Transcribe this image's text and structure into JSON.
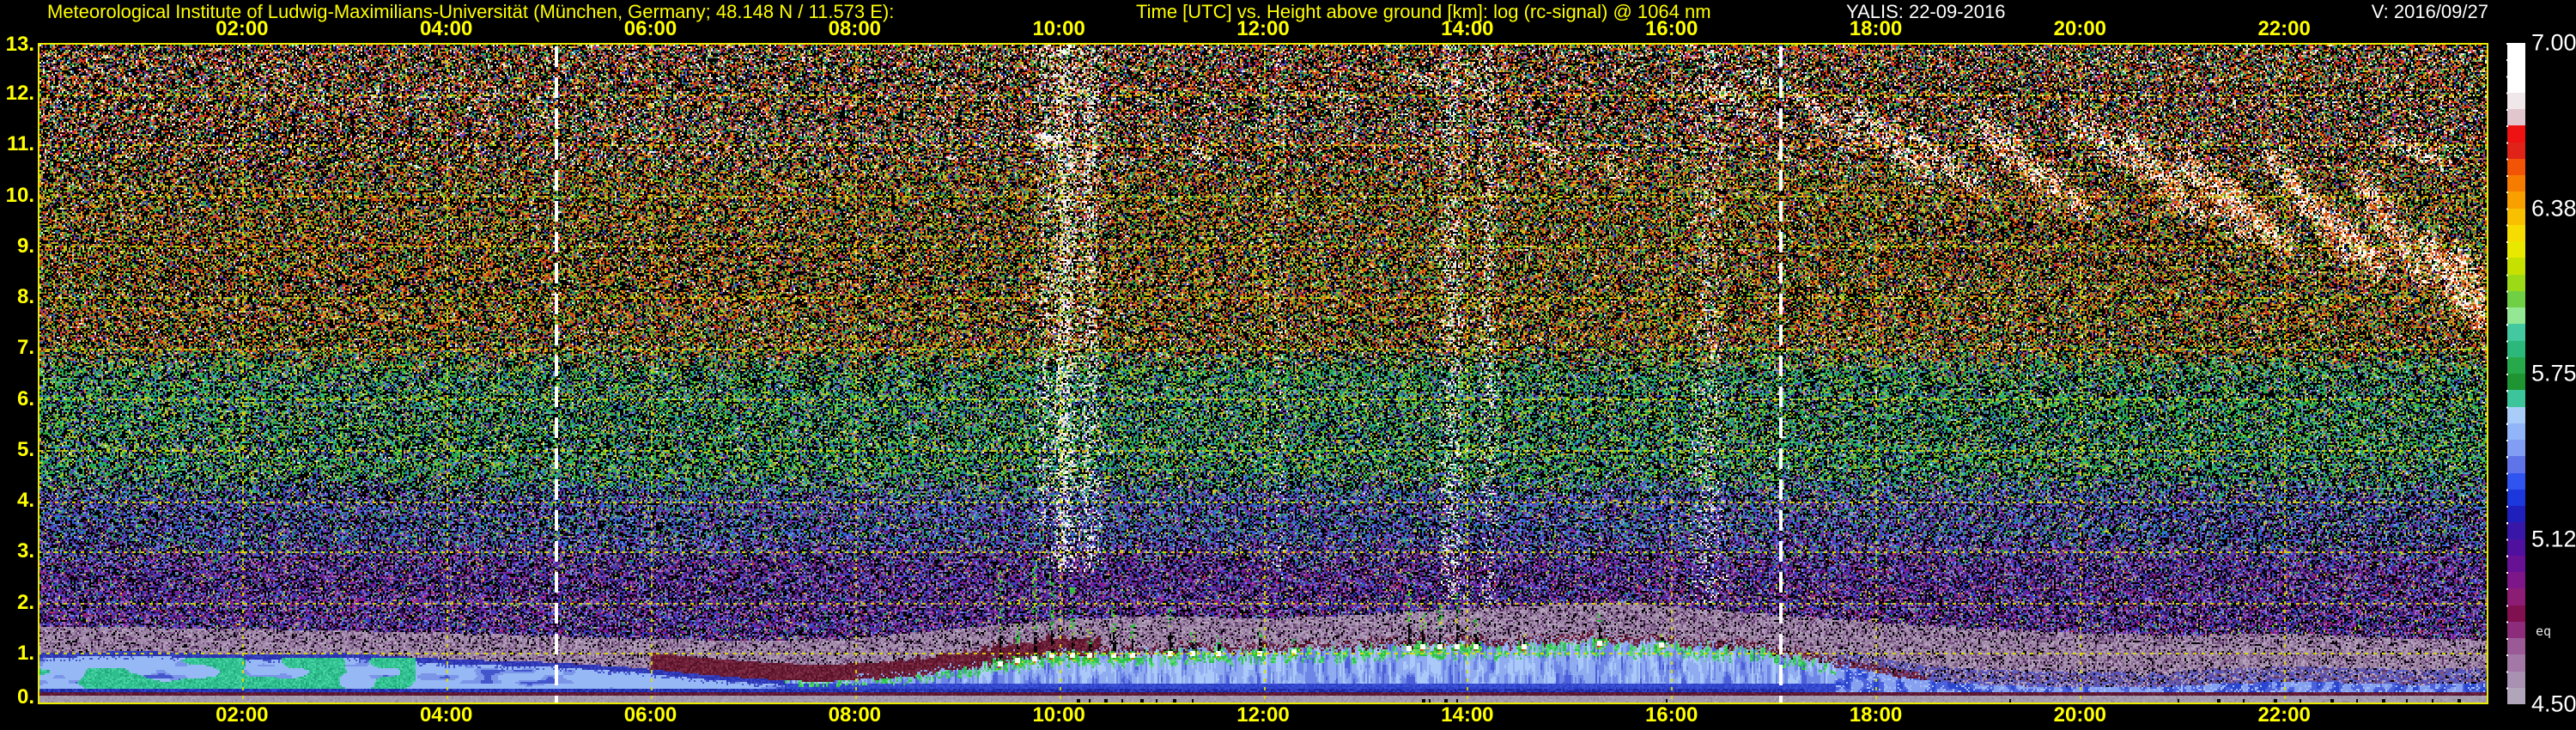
{
  "header": {
    "title_left": "Meteorological Institute of Ludwig-Maximilians-Universität (München, Germany; 48.148 N / 11.573 E):",
    "title_center": "Time [UTC] vs. Height above ground [km]: log (rc-signal) @ 1064 nm",
    "station_date": "YALIS: 22-09-2016",
    "version": "V: 2016/09/27"
  },
  "misc": {
    "eq_label": "eq"
  },
  "colors": {
    "background": "#000000",
    "title_yellow": "#ffff00",
    "title_white": "#ffffff",
    "axis_label_yellow": "#ffff00",
    "grid_yellow": "#d8d800",
    "plot_border_yellow": "#ecec00",
    "sun_line_white": "#ffffff",
    "colorbar_label_white": "#ffffff"
  },
  "chart_data": {
    "type": "heatmap",
    "title": "Time [UTC] vs. Height above ground [km]: log (rc-signal) @ 1064 nm",
    "xlabel": "Time [UTC]",
    "ylabel": "Height above ground [km]",
    "quantity": "log (rc-signal) @ 1064 nm",
    "date": "22-09-2016",
    "x_range_hours": [
      0,
      24
    ],
    "ylim_km": [
      0,
      13
    ],
    "grid": "dashed yellow, 2 h vertical / 1 km horizontal",
    "x_ticks": {
      "hours": [
        2,
        4,
        6,
        8,
        10,
        12,
        14,
        16,
        18,
        20,
        22
      ],
      "labels": [
        "02:00",
        "04:00",
        "06:00",
        "08:00",
        "10:00",
        "12:00",
        "14:00",
        "16:00",
        "18:00",
        "20:00",
        "22:00"
      ]
    },
    "y_ticks": {
      "values": [
        0,
        1,
        2,
        3,
        4,
        5,
        6,
        7,
        8,
        9,
        10,
        11,
        12,
        13
      ],
      "labels": [
        "0.",
        "1.",
        "2.",
        "3.",
        "4.",
        "5.",
        "6.",
        "7.",
        "8.",
        "9.",
        "10.",
        "11.",
        "12.",
        "13."
      ]
    },
    "colorbar": {
      "min": 4.5,
      "max": 7.0,
      "tick_labels": [
        "7.00",
        "6.38",
        "5.75",
        "5.12",
        "4.50"
      ],
      "tick_fracs": [
        0,
        0.25,
        0.5,
        0.75,
        1
      ],
      "colors": [
        "#ffffff",
        "#ffffff",
        "#ffffff",
        "#efe7e9",
        "#e2c6cd",
        "#ef1212",
        "#df2318",
        "#f25406",
        "#f67c00",
        "#f9a000",
        "#f9c000",
        "#f6dc00",
        "#e9e900",
        "#c6e000",
        "#9cd916",
        "#6fd046",
        "#95e893",
        "#43c89f",
        "#2cb87a",
        "#27a84a",
        "#1e9432",
        "#3cc49b",
        "#a9cdf8",
        "#91b5f8",
        "#829ef4",
        "#5f74e8",
        "#2f54f0",
        "#1c38dc",
        "#1f1fbc",
        "#3817a8",
        "#4f109e",
        "#671195",
        "#7c1689",
        "#8c1c74",
        "#801050",
        "#8c2c7a",
        "#995a96",
        "#a478a6",
        "#a991b1",
        "#b1a5b9"
      ]
    },
    "sun_lines_hours": [
      5.08,
      17.07
    ],
    "features": {
      "boundary_layer": "shallow nocturnal layer ~1 km with teal-green aerosol patches before ~03:30; convective plume growth 08:00-16:30 reaching ~1.2 km with small cumuli; decay to ~0.4 km after 17:30",
      "residual_haze": "mauve/gray haze layer above boundary layer up to ~1.3-2.0 km, dark maroon fringe 06:00-10:30",
      "clouds": "cirrus streaks 16:00-24:00 descending from ~12.5 to ~7.5 km, white to orange; thin high clouds near 09:45, 11:20, 12:40-14:30",
      "background": "colored speckle noise: orange/red above ~7 km, green 4-7 km, blue/purple 1.5-4 km",
      "surface_bands": "gray overlap band below ~0.19 km with maroon line above it"
    },
    "render": {
      "km_per_hour_aspect": 2.03,
      "bl_top": [
        [
          0,
          1.02
        ],
        [
          1,
          1.06
        ],
        [
          2,
          0.98
        ],
        [
          3,
          1.02
        ],
        [
          4,
          0.9
        ],
        [
          5,
          0.84
        ],
        [
          5.8,
          0.74
        ],
        [
          6.5,
          0.6
        ],
        [
          7,
          0.52
        ],
        [
          7.6,
          0.46
        ],
        [
          8.2,
          0.5
        ],
        [
          8.8,
          0.64
        ],
        [
          9.4,
          0.85
        ],
        [
          10,
          1.02
        ],
        [
          10.6,
          1.0
        ],
        [
          11.2,
          1.05
        ],
        [
          12,
          1.05
        ],
        [
          12.8,
          1.1
        ],
        [
          13.6,
          1.18
        ],
        [
          14.4,
          1.16
        ],
        [
          15.2,
          1.24
        ],
        [
          16,
          1.2
        ],
        [
          16.6,
          1.12
        ],
        [
          17.1,
          1.0
        ],
        [
          17.6,
          0.78
        ],
        [
          18.2,
          0.55
        ],
        [
          18.8,
          0.42
        ],
        [
          19.6,
          0.36
        ],
        [
          20.6,
          0.34
        ],
        [
          21.4,
          0.42
        ],
        [
          22.2,
          0.46
        ],
        [
          23.2,
          0.4
        ],
        [
          24,
          0.42
        ]
      ],
      "haze_top": [
        [
          0,
          1.55
        ],
        [
          2,
          1.5
        ],
        [
          4,
          1.42
        ],
        [
          6,
          1.3
        ],
        [
          7,
          1.26
        ],
        [
          8,
          1.32
        ],
        [
          9,
          1.5
        ],
        [
          10,
          1.68
        ],
        [
          11,
          1.76
        ],
        [
          12,
          1.7
        ],
        [
          13,
          1.78
        ],
        [
          14,
          1.9
        ],
        [
          15,
          1.98
        ],
        [
          15.6,
          2.02
        ],
        [
          16.2,
          1.9
        ],
        [
          17,
          1.78
        ],
        [
          18,
          1.62
        ],
        [
          19,
          1.5
        ],
        [
          20,
          1.42
        ],
        [
          21,
          1.36
        ],
        [
          22,
          1.42
        ],
        [
          23,
          1.32
        ],
        [
          24,
          1.28
        ]
      ],
      "green_patch_end_hour": 3.7,
      "cumulus": [
        [
          9.42,
          0.5,
          2.65
        ],
        [
          9.58,
          0.28,
          1.6
        ],
        [
          9.75,
          0.5,
          2.95
        ],
        [
          9.93,
          0.45,
          2.6
        ],
        [
          10.12,
          0.3,
          2.3
        ],
        [
          10.3,
          0.18,
          1.5
        ],
        [
          10.52,
          0.42,
          2.0
        ],
        [
          10.72,
          0.28,
          1.6
        ],
        [
          11.08,
          0.38,
          1.9
        ],
        [
          11.3,
          0.18,
          1.45
        ],
        [
          11.55,
          0.14,
          1.35
        ],
        [
          11.95,
          0.22,
          1.5
        ],
        [
          12.3,
          0.1,
          1.3
        ],
        [
          13.42,
          0.45,
          2.6
        ],
        [
          13.55,
          0.28,
          1.8
        ],
        [
          13.72,
          0.32,
          2.0
        ],
        [
          13.9,
          0.4,
          2.2
        ],
        [
          14.08,
          0.22,
          1.7
        ],
        [
          14.55,
          0.14,
          1.5
        ],
        [
          15.28,
          0.32,
          1.8
        ],
        [
          15.9,
          0.1,
          1.4
        ]
      ],
      "cirrus": [
        [
          16.25,
          12.3,
          16.95,
          11.5,
          0.22,
          0.3,
          0.2
        ],
        [
          17.15,
          12.1,
          17.85,
          11.0,
          0.25,
          0.35,
          0.25
        ],
        [
          17.7,
          11.7,
          18.6,
          10.3,
          0.28,
          0.45,
          0.3
        ],
        [
          18.3,
          11.3,
          19.1,
          10.0,
          0.25,
          0.4,
          0.3
        ],
        [
          18.9,
          11.6,
          19.6,
          10.4,
          0.3,
          0.55,
          0.35
        ],
        [
          19.2,
          11.0,
          20.1,
          9.7,
          0.3,
          0.6,
          0.45
        ],
        [
          19.9,
          11.6,
          20.8,
          10.2,
          0.28,
          0.5,
          0.35
        ],
        [
          20.4,
          11.2,
          21.2,
          9.5,
          0.3,
          0.65,
          0.5
        ],
        [
          20.9,
          11.0,
          21.7,
          9.1,
          0.28,
          0.6,
          0.5
        ],
        [
          21.2,
          10.5,
          22.1,
          8.9,
          0.3,
          0.7,
          0.55
        ],
        [
          21.8,
          10.9,
          22.7,
          8.7,
          0.28,
          0.6,
          0.5
        ],
        [
          22.25,
          9.9,
          23.0,
          8.5,
          0.32,
          0.8,
          0.6
        ],
        [
          22.7,
          10.5,
          23.4,
          8.2,
          0.28,
          0.65,
          0.5
        ],
        [
          23.3,
          9.3,
          23.85,
          7.7,
          0.3,
          0.75,
          0.55
        ],
        [
          23.65,
          9.0,
          24.0,
          7.3,
          0.3,
          0.7,
          0.5
        ],
        [
          23.0,
          11.2,
          23.6,
          10.6,
          0.2,
          0.4,
          0.3
        ],
        [
          9.7,
          11.25,
          10.0,
          11.05,
          0.12,
          0.5,
          0.1
        ],
        [
          11.25,
          10.95,
          11.5,
          10.7,
          0.1,
          0.55,
          0.15
        ],
        [
          12.65,
          12.1,
          12.95,
          11.8,
          0.12,
          0.35,
          0.1
        ],
        [
          13.35,
          12.4,
          13.75,
          12.15,
          0.12,
          0.35,
          0.1
        ],
        [
          13.95,
          12.2,
          14.3,
          11.9,
          0.12,
          0.3,
          0.1
        ],
        [
          14.55,
          11.1,
          15.0,
          10.7,
          0.15,
          0.3,
          0.15
        ],
        [
          15.15,
          10.7,
          15.6,
          10.3,
          0.15,
          0.25,
          0.15
        ],
        [
          16.6,
          12.5,
          17.0,
          12.2,
          0.12,
          0.3,
          0.15
        ]
      ],
      "bright_columns": [
        [
          10.05,
          0.1,
          0.45,
          2.6
        ],
        [
          10.3,
          0.08,
          0.3,
          2.6
        ],
        [
          9.85,
          0.06,
          0.22,
          3.5
        ],
        [
          13.85,
          0.09,
          0.28,
          2.0
        ],
        [
          14.2,
          0.07,
          0.22,
          2.0
        ],
        [
          16.35,
          0.13,
          0.18,
          2.0
        ],
        [
          12.15,
          0.05,
          0.12,
          2.4
        ]
      ],
      "bottom_marks": [
        [
          10.18,
          2
        ],
        [
          10.3,
          1
        ],
        [
          10.45,
          2
        ],
        [
          10.62,
          1
        ],
        [
          10.8,
          2
        ],
        [
          10.95,
          1
        ],
        [
          11.12,
          2
        ],
        [
          11.3,
          1
        ],
        [
          13.55,
          2
        ],
        [
          13.62,
          1
        ],
        [
          13.78,
          2
        ],
        [
          13.9,
          1
        ],
        [
          15.95,
          1
        ],
        [
          19.3,
          1
        ],
        [
          20.95,
          1
        ],
        [
          21.35,
          2
        ],
        [
          21.6,
          1
        ],
        [
          21.9,
          2
        ],
        [
          22.15,
          1
        ],
        [
          22.45,
          2
        ],
        [
          22.7,
          1
        ],
        [
          22.95,
          2
        ],
        [
          23.2,
          1
        ],
        [
          23.45,
          1
        ],
        [
          23.7,
          2
        ]
      ],
      "palettes": {
        "top": [
          [
            "#000000",
            0.42
          ],
          [
            "#e05818",
            0.1
          ],
          [
            "#d02018",
            0.08
          ],
          [
            "#d8c020",
            0.08
          ],
          [
            "#30a030",
            0.08
          ],
          [
            "#f0f0f0",
            0.06
          ],
          [
            "#c8a878",
            0.03
          ],
          [
            "#3048c0",
            0.05
          ],
          [
            "#b838a0",
            0.04
          ],
          [
            "#28a888",
            0.05
          ],
          [
            "#e8e8e8",
            0.01
          ]
        ],
        "hi": [
          [
            "#000000",
            0.4
          ],
          [
            "#d86018",
            0.12
          ],
          [
            "#c82818",
            0.08
          ],
          [
            "#d0c020",
            0.1
          ],
          [
            "#38a030",
            0.1
          ],
          [
            "#e8e8e8",
            0.03
          ],
          [
            "#88b030",
            0.06
          ],
          [
            "#3048b8",
            0.04
          ],
          [
            "#a83898",
            0.03
          ],
          [
            "#28a078",
            0.04
          ]
        ],
        "midgreen": [
          [
            "#000000",
            0.38
          ],
          [
            "#28a838",
            0.14
          ],
          [
            "#20a878",
            0.1
          ],
          [
            "#90c828",
            0.08
          ],
          [
            "#c8c828",
            0.06
          ],
          [
            "#3858c8",
            0.08
          ],
          [
            "#38b8a8",
            0.06
          ],
          [
            "#7038a8",
            0.05
          ],
          [
            "#d87828",
            0.02
          ],
          [
            "#e8e8e8",
            0.01
          ],
          [
            "#8890e0",
            0.02
          ]
        ],
        "bluepurple": [
          [
            "#000000",
            0.34
          ],
          [
            "#28a070",
            0.06
          ],
          [
            "#30a040",
            0.05
          ],
          [
            "#3858d0",
            0.14
          ],
          [
            "#8890e8",
            0.08
          ],
          [
            "#6830a0",
            0.13
          ],
          [
            "#98309a",
            0.06
          ],
          [
            "#c8c830",
            0.04
          ],
          [
            "#2878d8",
            0.06
          ],
          [
            "#501878",
            0.04
          ]
        ],
        "purple": [
          [
            "#000000",
            0.28
          ],
          [
            "#5c2890",
            0.16
          ],
          [
            "#8c189c",
            0.09
          ],
          [
            "#3040c8",
            0.12
          ],
          [
            "#8088e0",
            0.07
          ],
          [
            "#a868a8",
            0.09
          ],
          [
            "#301050",
            0.09
          ],
          [
            "#c8c830",
            0.02
          ],
          [
            "#28a060",
            0.03
          ],
          [
            "#c03040",
            0.02
          ],
          [
            "#6858c8",
            0.03
          ]
        ],
        "haze": [
          [
            "#9a82a2",
            0.32
          ],
          [
            "#ab93b3",
            0.2
          ],
          [
            "#7a5884",
            0.16
          ],
          [
            "#5c3268",
            0.1
          ],
          [
            "#000000",
            0.1
          ],
          [
            "#b7a7bf",
            0.12
          ]
        ],
        "maroon": [
          [
            "#6c1e36",
            0.45
          ],
          [
            "#571229",
            0.3
          ],
          [
            "#82304a",
            0.25
          ]
        ],
        "green_cloud": [
          [
            "#2cc040",
            0.4
          ],
          [
            "#7ed822",
            0.25
          ],
          [
            "#1ba02c",
            0.2
          ],
          [
            "#d8d020",
            0.1
          ],
          [
            "#28a878",
            0.05
          ]
        ],
        "cirrus_white": [
          [
            "#ffffff",
            0.5
          ],
          [
            "#f2e8da",
            0.25
          ],
          [
            "#fce8c8",
            0.15
          ],
          [
            "#e8e8f0",
            0.1
          ]
        ],
        "cirrus_orange": [
          [
            "#f08030",
            0.35
          ],
          [
            "#e05a14",
            0.3
          ],
          [
            "#d03008",
            0.2
          ],
          [
            "#f8b060",
            0.15
          ]
        ],
        "bl_teal": [
          [
            "#2fbf8f",
            0.55
          ],
          [
            "#46d2a2",
            0.3
          ],
          [
            "#23a87c",
            0.15
          ]
        ]
      }
    }
  }
}
